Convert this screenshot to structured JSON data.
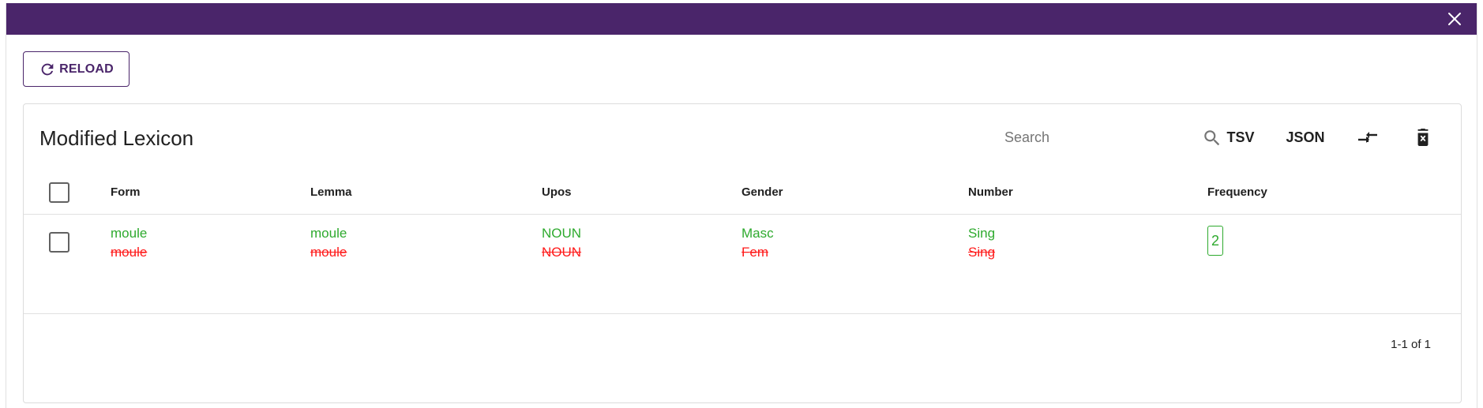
{
  "dialog": {
    "close_icon": "close-icon"
  },
  "toolbar": {
    "reload_label": "RELOAD",
    "reload_icon": "refresh-icon"
  },
  "lexicon": {
    "title": "Modified Lexicon",
    "search_placeholder": "Search",
    "search_icon": "search-icon",
    "tsv_label": "TSV",
    "json_label": "JSON",
    "compare_icon": "compare-arrows-icon",
    "delete_icon": "delete-forever-icon",
    "columns": [
      "Form",
      "Lemma",
      "Upos",
      "Gender",
      "Number",
      "Frequency"
    ],
    "rows": [
      {
        "form": {
          "new": "moule",
          "old": "moule"
        },
        "lemma": {
          "new": "moule",
          "old": "moule"
        },
        "upos": {
          "new": "NOUN",
          "old": "NOUN"
        },
        "gender": {
          "new": "Masc",
          "old": "Fem"
        },
        "number": {
          "new": "Sing",
          "old": "Sing"
        },
        "frequency": "2"
      }
    ],
    "pagination": "1-1 of 1"
  },
  "colors": {
    "header_bar": "#4a256a",
    "new_value": "#2eaa2e",
    "old_value": "#ff1a1a"
  }
}
